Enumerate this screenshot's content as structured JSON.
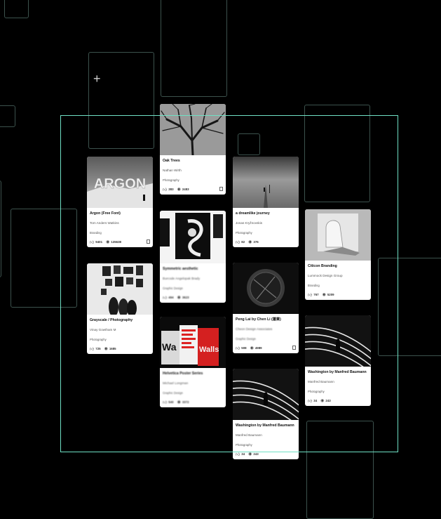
{
  "cards": [
    {
      "title": "Argon (Free Font)",
      "owner": "Tom Anders Watkins",
      "category": "Branding",
      "likes": "9401",
      "views": "135638"
    },
    {
      "title": "Grayscale / Photography",
      "owner": "Vinay Gowtham M",
      "category": "Photography",
      "likes": "725",
      "views": "1685"
    },
    {
      "title": "Oak Trees",
      "owner": "Nathan Wirth",
      "category": "Photography",
      "likes": "383",
      "views": "2483"
    },
    {
      "title": "Symmetric aesthetic",
      "owner": "Burcode Angelopak Brady",
      "category": "Graphic Design",
      "likes": "494",
      "views": "3623"
    },
    {
      "title": "Helvetica Poster Series",
      "owner": "Michael Longman",
      "category": "Graphic Design",
      "likes": "540",
      "views": "3372"
    },
    {
      "title": "a dreamlike journey",
      "owner": "Jonas Kryžnovskis",
      "category": "Photography",
      "likes": "82",
      "views": "376"
    },
    {
      "title": "Peng Lai by Chen Li (蓬莱)",
      "owner": "Cheon Design Associates",
      "category": "Graphic Design",
      "likes": "508",
      "views": "4989"
    },
    {
      "title": "Washington by Manfred Baumann",
      "owner": "Manfred Baumann",
      "category": "Photography",
      "likes": "34",
      "views": "243"
    },
    {
      "title": "Citicon Branding",
      "owner": "Lummock Design Group",
      "category": "Branding",
      "likes": "767",
      "views": "5209"
    },
    {
      "title": "Washington by Manfred Baumann",
      "owner": "Manfred Baumann",
      "category": "Photography",
      "likes": "34",
      "views": "243"
    }
  ],
  "thumb_text": {
    "argon": "ARGON",
    "helvetica_a": "Wa",
    "helvetica_b": "Walls"
  },
  "icons": {
    "like": "thumbs-up-icon",
    "view": "eye-icon",
    "report": "flag-icon",
    "crosshair": "plus-icon"
  },
  "colors": {
    "background": "#000000",
    "selection": "#6fe0c4",
    "frame": "#4d6b63",
    "card": "#ffffff"
  }
}
